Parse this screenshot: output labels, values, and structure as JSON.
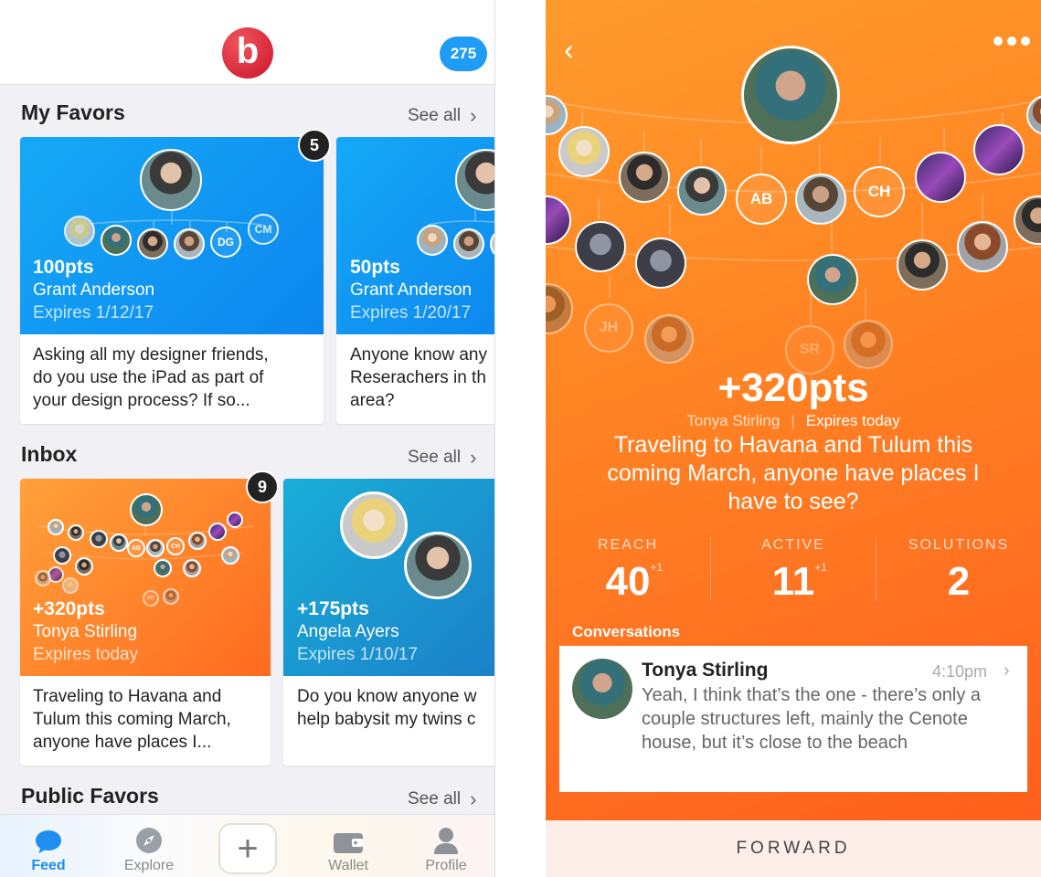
{
  "left": {
    "logo_letter": "b",
    "badge_count": "275",
    "sections": {
      "favors": {
        "title": "My Favors",
        "see_all": "See all"
      },
      "inbox": {
        "title": "Inbox",
        "see_all": "See all"
      },
      "public": {
        "title": "Public Favors",
        "see_all": "See all"
      }
    },
    "favor_cards": [
      {
        "pts": "100pts",
        "who": "Grant Anderson",
        "expires": "Expires 1/12/17",
        "body": [
          "Asking all my designer friends,",
          "do you use the iPad as part of",
          "your design process? If so..."
        ],
        "notif": "5",
        "initials": [
          "DG",
          "CM"
        ]
      },
      {
        "pts": "50pts",
        "who": "Grant Anderson",
        "expires": "Expires 1/20/17",
        "body": [
          "Anyone know any",
          "Reserachers in th",
          "area?"
        ]
      }
    ],
    "inbox_cards": [
      {
        "pts": "+320pts",
        "who": "Tonya Stirling",
        "expires": "Expires today",
        "body": [
          "Traveling to Havana and",
          "Tulum this coming March,",
          "anyone have places I..."
        ],
        "notif": "9",
        "initials": [
          "AB",
          "CH",
          "SR"
        ]
      },
      {
        "pts": "+175pts",
        "who": "Angela Ayers",
        "expires": "Expires 1/10/17",
        "body": [
          "Do you know anyone w",
          "help babysit my twins c"
        ]
      }
    ],
    "tabs": [
      {
        "label": "Feed",
        "icon": "chat-bubble-icon",
        "active": true
      },
      {
        "label": "Explore",
        "icon": "compass-icon",
        "active": false
      },
      {
        "label": "",
        "icon": "plus-icon",
        "active": false
      },
      {
        "label": "Wallet",
        "icon": "wallet-icon",
        "active": false
      },
      {
        "label": "Profile",
        "icon": "person-icon",
        "active": false
      }
    ],
    "colors": {
      "accent": "#1f9cf5",
      "logo": "#d91f33",
      "card_blue": "#0c86ee",
      "card_orange": "#ff6a1f"
    }
  },
  "right": {
    "back_icon": "chevron-left-icon",
    "more_icon": "ellipsis-icon",
    "tree_initials": [
      "AB",
      "CH",
      "JH",
      "SR"
    ],
    "points": "+320pts",
    "author": "Tonya Stirling",
    "separator": "|",
    "expires": "Expires today",
    "question": "Traveling to Havana and Tulum this coming March, anyone have places I have to see?",
    "stats": [
      {
        "label": "REACH",
        "value": "40",
        "delta": "+1"
      },
      {
        "label": "ACTIVE",
        "value": "11",
        "delta": "+1"
      },
      {
        "label": "SOLUTIONS",
        "value": "2",
        "delta": ""
      }
    ],
    "conversations_label": "Conversations",
    "conversation": {
      "name": "Tonya Stirling",
      "time": "4:10pm",
      "message": "Yeah, I think that’s the one - there’s only a couple structures left, mainly the Cenote house, but it’s close to the beach"
    },
    "forward_label": "FORWARD",
    "colors": {
      "bg_top": "#ff9b2e",
      "bg_bottom": "#ff5a1a",
      "forward_bg": "#fdeee9"
    }
  }
}
